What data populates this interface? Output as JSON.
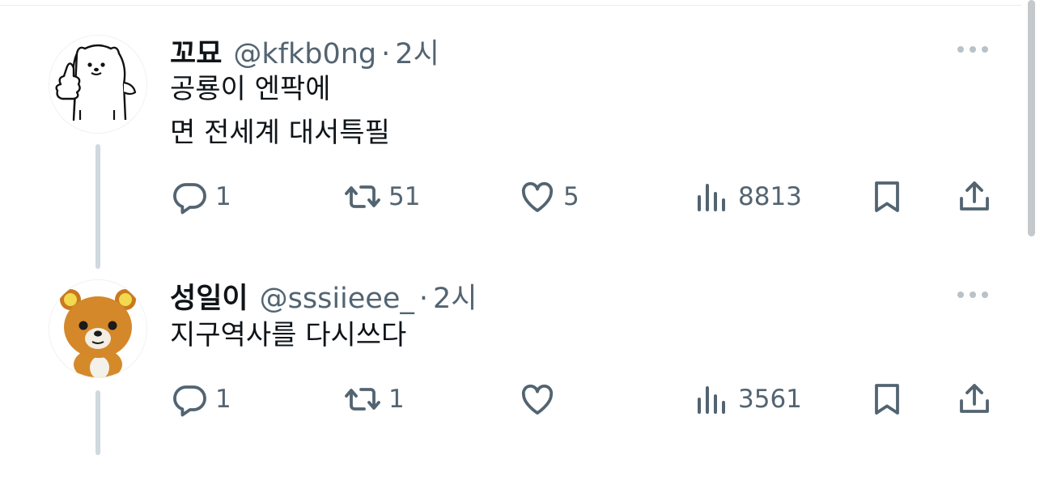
{
  "tweets": [
    {
      "name": "꼬묘",
      "handle": "@kfkb0ng",
      "separator": "·",
      "time": "2시",
      "lines": [
        "공룡이 엔팍에",
        "면 전세계 대서특필"
      ],
      "actions": {
        "reply": "1",
        "retweet": "51",
        "like": "5",
        "views": "8813"
      }
    },
    {
      "name": "성일이",
      "handle": "@sssiieee_",
      "separator": "·",
      "time": "2시",
      "lines": [
        "지구역사를 다시쓰다"
      ],
      "actions": {
        "reply": "1",
        "retweet": "1",
        "like": "",
        "views": "3561"
      }
    }
  ],
  "icons": [
    "more-icon",
    "reply-icon",
    "retweet-icon",
    "like-icon",
    "views-icon",
    "bookmark-icon",
    "share-icon"
  ],
  "colors": {
    "text": "#0f1419",
    "secondary": "#536471",
    "thread_line": "#cfd9de"
  }
}
